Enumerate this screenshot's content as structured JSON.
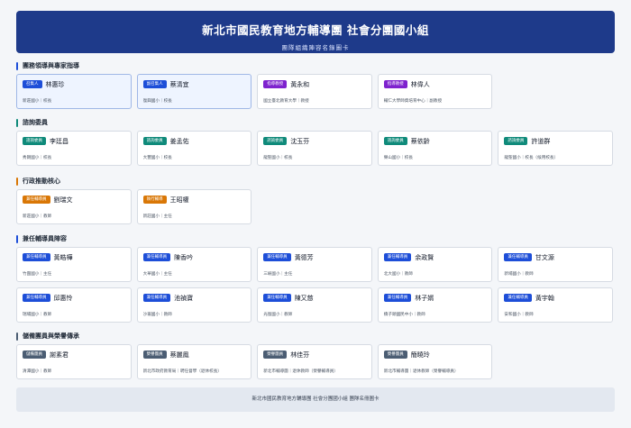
{
  "banner": {
    "title": "新北市國民教育地方輔導團 社會分團國小組",
    "subtitle": "團隊組織陣容名錄圖卡"
  },
  "colors": {
    "lead": "#1d4ed8",
    "advisor": "#7e22ce",
    "consult": "#0f8a7a",
    "admin": "#d97706",
    "fulltime": "#1d4ed8",
    "reserve": "#4b5d73"
  },
  "sections": [
    {
      "title": "團務領導與專家指導",
      "bar_color": "#1d4ed8",
      "members": [
        {
          "badge": "召集人",
          "name": "林惠珍",
          "org": "新莊國小｜校長",
          "color": "#1d4ed8",
          "highlight": true
        },
        {
          "badge": "副召集人",
          "name": "蔡清宜",
          "org": "復興國小｜校長",
          "color": "#1d4ed8",
          "highlight": true
        },
        {
          "badge": "指導教授",
          "name": "黃永和",
          "org": "國立臺北教育大學｜教授",
          "color": "#7e22ce",
          "highlight": false
        },
        {
          "badge": "指導教授",
          "name": "林偉人",
          "org": "輔仁大學師資培育中心｜副教授",
          "color": "#7e22ce",
          "highlight": false
        }
      ]
    },
    {
      "title": "諮詢委員",
      "bar_color": "#0f8a7a",
      "members": [
        {
          "badge": "諮詢委員",
          "name": "李廷昌",
          "org": "秀朗國小｜校長",
          "color": "#0f8a7a"
        },
        {
          "badge": "諮詢委員",
          "name": "姜孟佑",
          "org": "大豐國小｜校長",
          "color": "#0f8a7a"
        },
        {
          "badge": "諮詢委員",
          "name": "沈玉芬",
          "org": "龍聖國小｜校長",
          "color": "#0f8a7a"
        },
        {
          "badge": "諮詢委員",
          "name": "蔡依齡",
          "org": "樂山國小｜校長",
          "color": "#0f8a7a"
        },
        {
          "badge": "諮詢委員",
          "name": "許道群",
          "org": "龍聖國小｜校長（候用校長）",
          "color": "#0f8a7a"
        }
      ]
    },
    {
      "title": "行政推動核心",
      "bar_color": "#d97706",
      "members": [
        {
          "badge": "兼任輔導員",
          "name": "劉瑞文",
          "org": "新莊國小｜教師",
          "color": "#d97706"
        },
        {
          "badge": "執行輔導",
          "name": "王昭權",
          "org": "新莊國小｜主任",
          "color": "#d97706"
        }
      ]
    },
    {
      "title": "兼任輔導員陣容",
      "bar_color": "#1d4ed8",
      "members": [
        {
          "badge": "兼任輔導員",
          "name": "黃皓樺",
          "org": "竹圍國小｜主任",
          "color": "#1d4ed8"
        },
        {
          "badge": "兼任輔導員",
          "name": "陳香吟",
          "org": "大華國小｜主任",
          "color": "#1d4ed8"
        },
        {
          "badge": "兼任輔導員",
          "name": "黃德芳",
          "org": "三峽國小｜主任",
          "color": "#1d4ed8"
        },
        {
          "badge": "兼任輔導員",
          "name": "余政賢",
          "org": "北大國小｜教師",
          "color": "#1d4ed8"
        },
        {
          "badge": "兼任輔導員",
          "name": "甘文源",
          "org": "新埔國小｜教師",
          "color": "#1d4ed8"
        },
        {
          "badge": "兼任輔導員",
          "name": "邱惠怜",
          "org": "瑞埔國小｜教師",
          "color": "#1d4ed8"
        },
        {
          "badge": "兼任輔導員",
          "name": "池禎寶",
          "org": "沙崙國小｜教師",
          "color": "#1d4ed8"
        },
        {
          "badge": "兼任輔導員",
          "name": "陳又慈",
          "org": "光復國小｜教師",
          "color": "#1d4ed8"
        },
        {
          "badge": "兼任輔導員",
          "name": "林子婿",
          "org": "橋子頭國民中小｜教師",
          "color": "#1d4ed8"
        },
        {
          "badge": "兼任輔導員",
          "name": "黃宇翰",
          "org": "安和國小｜教師",
          "color": "#1d4ed8"
        }
      ]
    },
    {
      "title": "儲備團員與榮譽傳承",
      "bar_color": "#4b5d73",
      "members": [
        {
          "badge": "儲備團員",
          "name": "謝素君",
          "org": "清潭國小｜教師",
          "color": "#4b5d73"
        },
        {
          "badge": "榮譽團員",
          "name": "蔡麗鳳",
          "org": "新北市政府教育局｜聘任督學（退休校長）",
          "color": "#4b5d73"
        },
        {
          "badge": "榮譽團員",
          "name": "林佳芬",
          "org": "新北市輔導團｜退休教師（榮譽輔導員）",
          "color": "#4b5d73"
        },
        {
          "badge": "榮譽團員",
          "name": "簡曉玲",
          "org": "新北市輔導團｜退休教師（榮譽輔導員）",
          "color": "#4b5d73"
        }
      ]
    }
  ],
  "footer": {
    "text": "新北市國民教育地方輔導團 社會分團國小組 團隊名冊圖卡"
  }
}
